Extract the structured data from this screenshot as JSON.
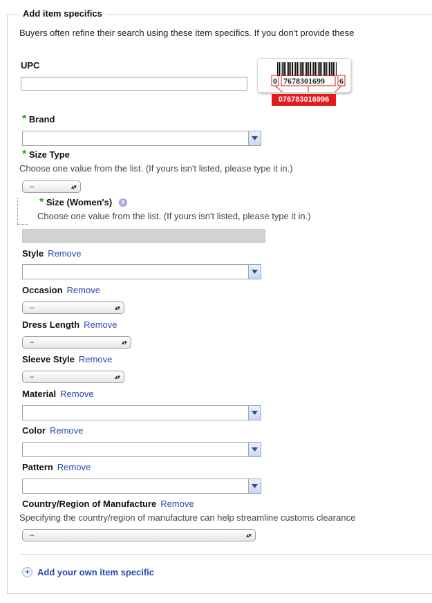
{
  "section": {
    "legend": "Add item specifics",
    "intro": "Buyers often refine their search using these item specifics. If you don't provide these"
  },
  "upc": {
    "label": "UPC",
    "value": "",
    "barcode": {
      "left_digit": "0",
      "middle_digits": "7678301699",
      "right_digit": "6",
      "highlight": "076783016996"
    }
  },
  "brand": {
    "label": "Brand",
    "value": ""
  },
  "size_type": {
    "label": "Size Type",
    "help": "Choose one value from the list. (If yours isn't listed, please type it in.)",
    "selected": "–"
  },
  "size_womens": {
    "label": "Size (Women's)",
    "help": "Choose one value from the list. (If yours isn't listed, please type it in.)"
  },
  "remove_label": "Remove",
  "style": {
    "label": "Style",
    "value": ""
  },
  "occasion": {
    "label": "Occasion",
    "selected": "–"
  },
  "dress_length": {
    "label": "Dress Length",
    "selected": "–"
  },
  "sleeve_style": {
    "label": "Sleeve Style",
    "selected": "–"
  },
  "material": {
    "label": "Material",
    "value": ""
  },
  "color": {
    "label": "Color",
    "value": ""
  },
  "pattern": {
    "label": "Pattern",
    "value": ""
  },
  "country": {
    "label": "Country/Region of Manufacture",
    "help": "Specifying the country/region of manufacture can help streamline customs clearance",
    "selected": "–"
  },
  "add_own": "Add your own item specific",
  "required_mark": "*",
  "colors": {
    "required": "#2f9e1e",
    "link": "#2548b5",
    "barcode_red": "#e31b1b"
  }
}
